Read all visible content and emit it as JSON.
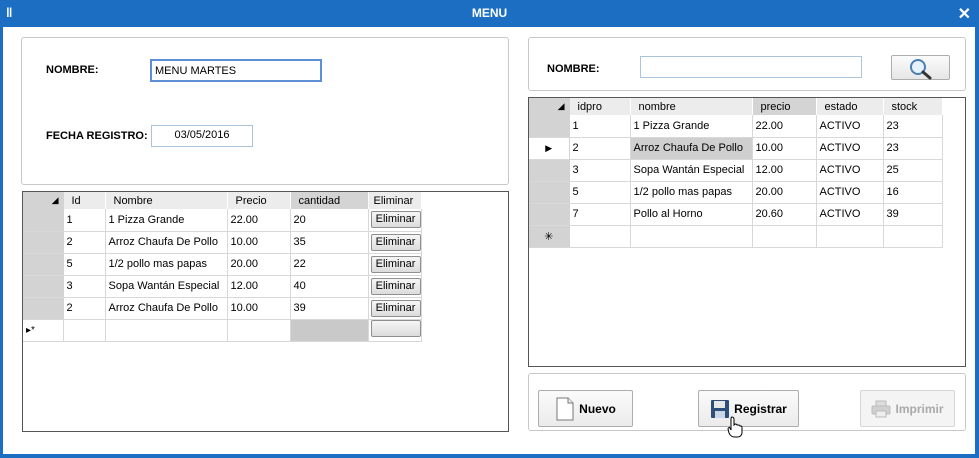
{
  "window": {
    "title": "MENU",
    "app_icon": "‖",
    "close": "✕"
  },
  "left_form": {
    "nombre_label": "NOMBRE:",
    "nombre_value": "MENU MARTES",
    "fecha_label": "FECHA REGISTRO:",
    "fecha_value": "03/05/2016"
  },
  "left_grid": {
    "headers": [
      "Id",
      "Nombre",
      "Precio",
      "cantidad",
      "Eliminar"
    ],
    "rows": [
      {
        "id": "1",
        "nombre": "1 Pizza Grande",
        "precio": "22.00",
        "cantidad": "20",
        "eliminar": "Eliminar"
      },
      {
        "id": "2",
        "nombre": "Arroz Chaufa De Pollo",
        "precio": "10.00",
        "cantidad": "35",
        "eliminar": "Eliminar"
      },
      {
        "id": "5",
        "nombre": "1/2 pollo mas papas",
        "precio": "20.00",
        "cantidad": "22",
        "eliminar": "Eliminar"
      },
      {
        "id": "3",
        "nombre": "Sopa Wantán Especial",
        "precio": "12.00",
        "cantidad": "40",
        "eliminar": "Eliminar"
      },
      {
        "id": "2",
        "nombre": "Arroz Chaufa De Pollo",
        "precio": "10.00",
        "cantidad": "39",
        "eliminar": "Eliminar"
      }
    ],
    "new_row_marker": "▸*"
  },
  "right_search": {
    "nombre_label": "NOMBRE:",
    "nombre_value": "",
    "search_icon": "magnifier-icon"
  },
  "right_grid": {
    "headers": [
      "idpro",
      "nombre",
      "precio",
      "estado",
      "stock"
    ],
    "rows": [
      {
        "idpro": "1",
        "nombre": "1 Pizza Grande",
        "precio": "22.00",
        "estado": "ACTIVO",
        "stock": "23"
      },
      {
        "idpro": "2",
        "nombre": "Arroz Chaufa De Pollo",
        "precio": "10.00",
        "estado": "ACTIVO",
        "stock": "23"
      },
      {
        "idpro": "3",
        "nombre": "Sopa Wantán Especial",
        "precio": "12.00",
        "estado": "ACTIVO",
        "stock": "25"
      },
      {
        "idpro": "5",
        "nombre": "1/2 pollo mas papas",
        "precio": "20.00",
        "estado": "ACTIVO",
        "stock": "16"
      },
      {
        "idpro": "7",
        "nombre": "Pollo al Horno",
        "precio": "20.60",
        "estado": "ACTIVO",
        "stock": "39"
      }
    ],
    "current_row_marker": "▶",
    "new_row_marker": "✳"
  },
  "buttons": {
    "nuevo": "Nuevo",
    "registrar": "Registrar",
    "imprimir": "Imprimir"
  },
  "colors": {
    "titlebar": "#1b6ec2",
    "grid_header": "#ececec",
    "row_header": "#d3d3d3"
  }
}
